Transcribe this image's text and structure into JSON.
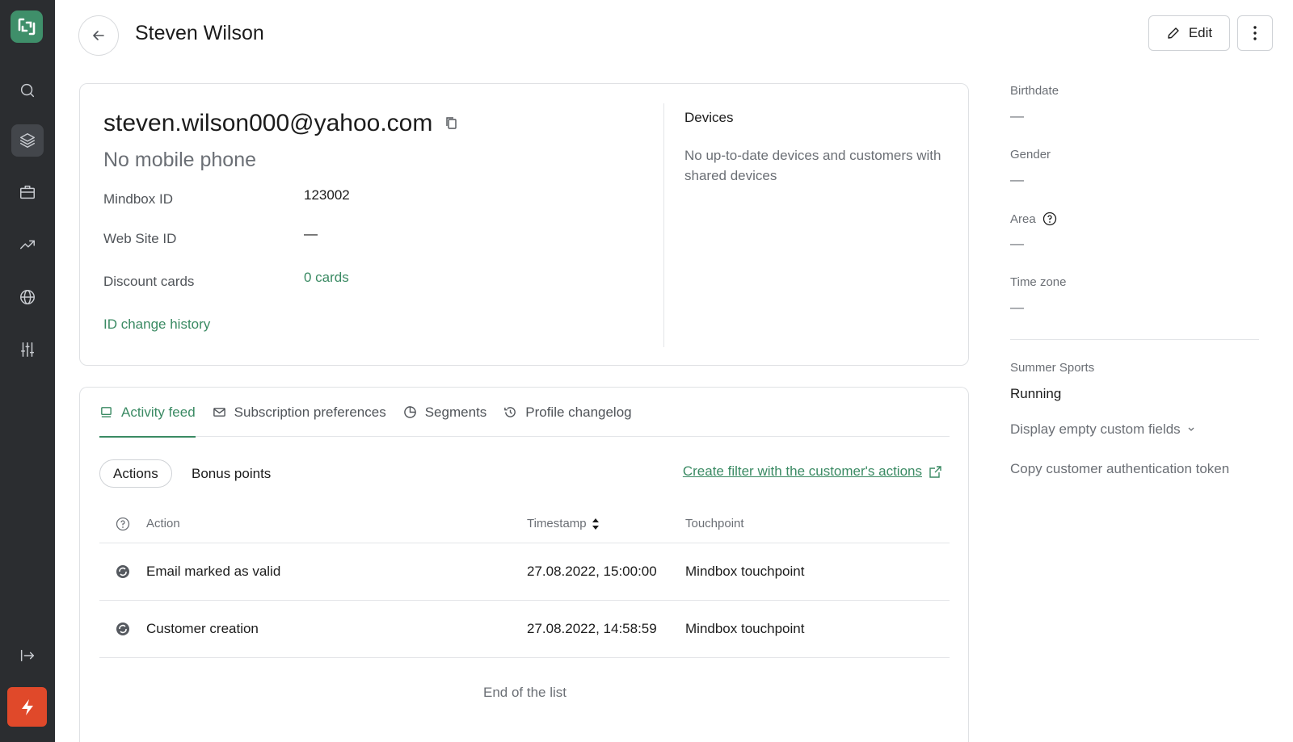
{
  "header": {
    "title": "Steven Wilson",
    "edit_label": "Edit"
  },
  "profile": {
    "email": "steven.wilson000@yahoo.com",
    "phone": "No mobile phone",
    "fields": [
      {
        "label": "Mindbox ID",
        "value": "123002"
      },
      {
        "label": "Web Site ID",
        "value": "—"
      },
      {
        "label": "Discount cards",
        "value": "0 cards"
      }
    ],
    "id_history_link": "ID change history"
  },
  "devices": {
    "title": "Devices",
    "text": "No up-to-date devices and customers with shared devices"
  },
  "tabs": [
    {
      "label": "Activity feed",
      "icon": "feed-icon",
      "active": true
    },
    {
      "label": "Subscription preferences",
      "icon": "envelope-icon",
      "active": false
    },
    {
      "label": "Segments",
      "icon": "pie-chart-icon",
      "active": false
    },
    {
      "label": "Profile changelog",
      "icon": "history-icon",
      "active": false
    }
  ],
  "activity": {
    "filters": [
      "Actions",
      "Bonus points"
    ],
    "create_filter_link": "Create filter with the customer's actions",
    "columns": {
      "action": "Action",
      "timestamp": "Timestamp",
      "touchpoint": "Touchpoint"
    },
    "rows": [
      {
        "action": "Email marked as valid",
        "timestamp": "27.08.2022, 15:00:00",
        "touchpoint": "Mindbox touchpoint"
      },
      {
        "action": "Customer creation",
        "timestamp": "27.08.2022, 14:58:59",
        "touchpoint": "Mindbox touchpoint"
      }
    ],
    "end_text": "End of the list"
  },
  "details": {
    "birthdate_label": "Birthdate",
    "birthdate_value": "—",
    "gender_label": "Gender",
    "gender_value": "—",
    "area_label": "Area",
    "area_value": "—",
    "timezone_label": "Time zone",
    "timezone_value": "—",
    "custom_label": "Summer Sports",
    "custom_value": "Running",
    "display_empty": "Display empty custom fields",
    "copy_token": "Copy customer authentication token"
  },
  "colors": {
    "accent": "#3a8a63",
    "sidebar": "#2b2d30",
    "flash": "#e0492a",
    "logo": "#3f8f6a"
  }
}
